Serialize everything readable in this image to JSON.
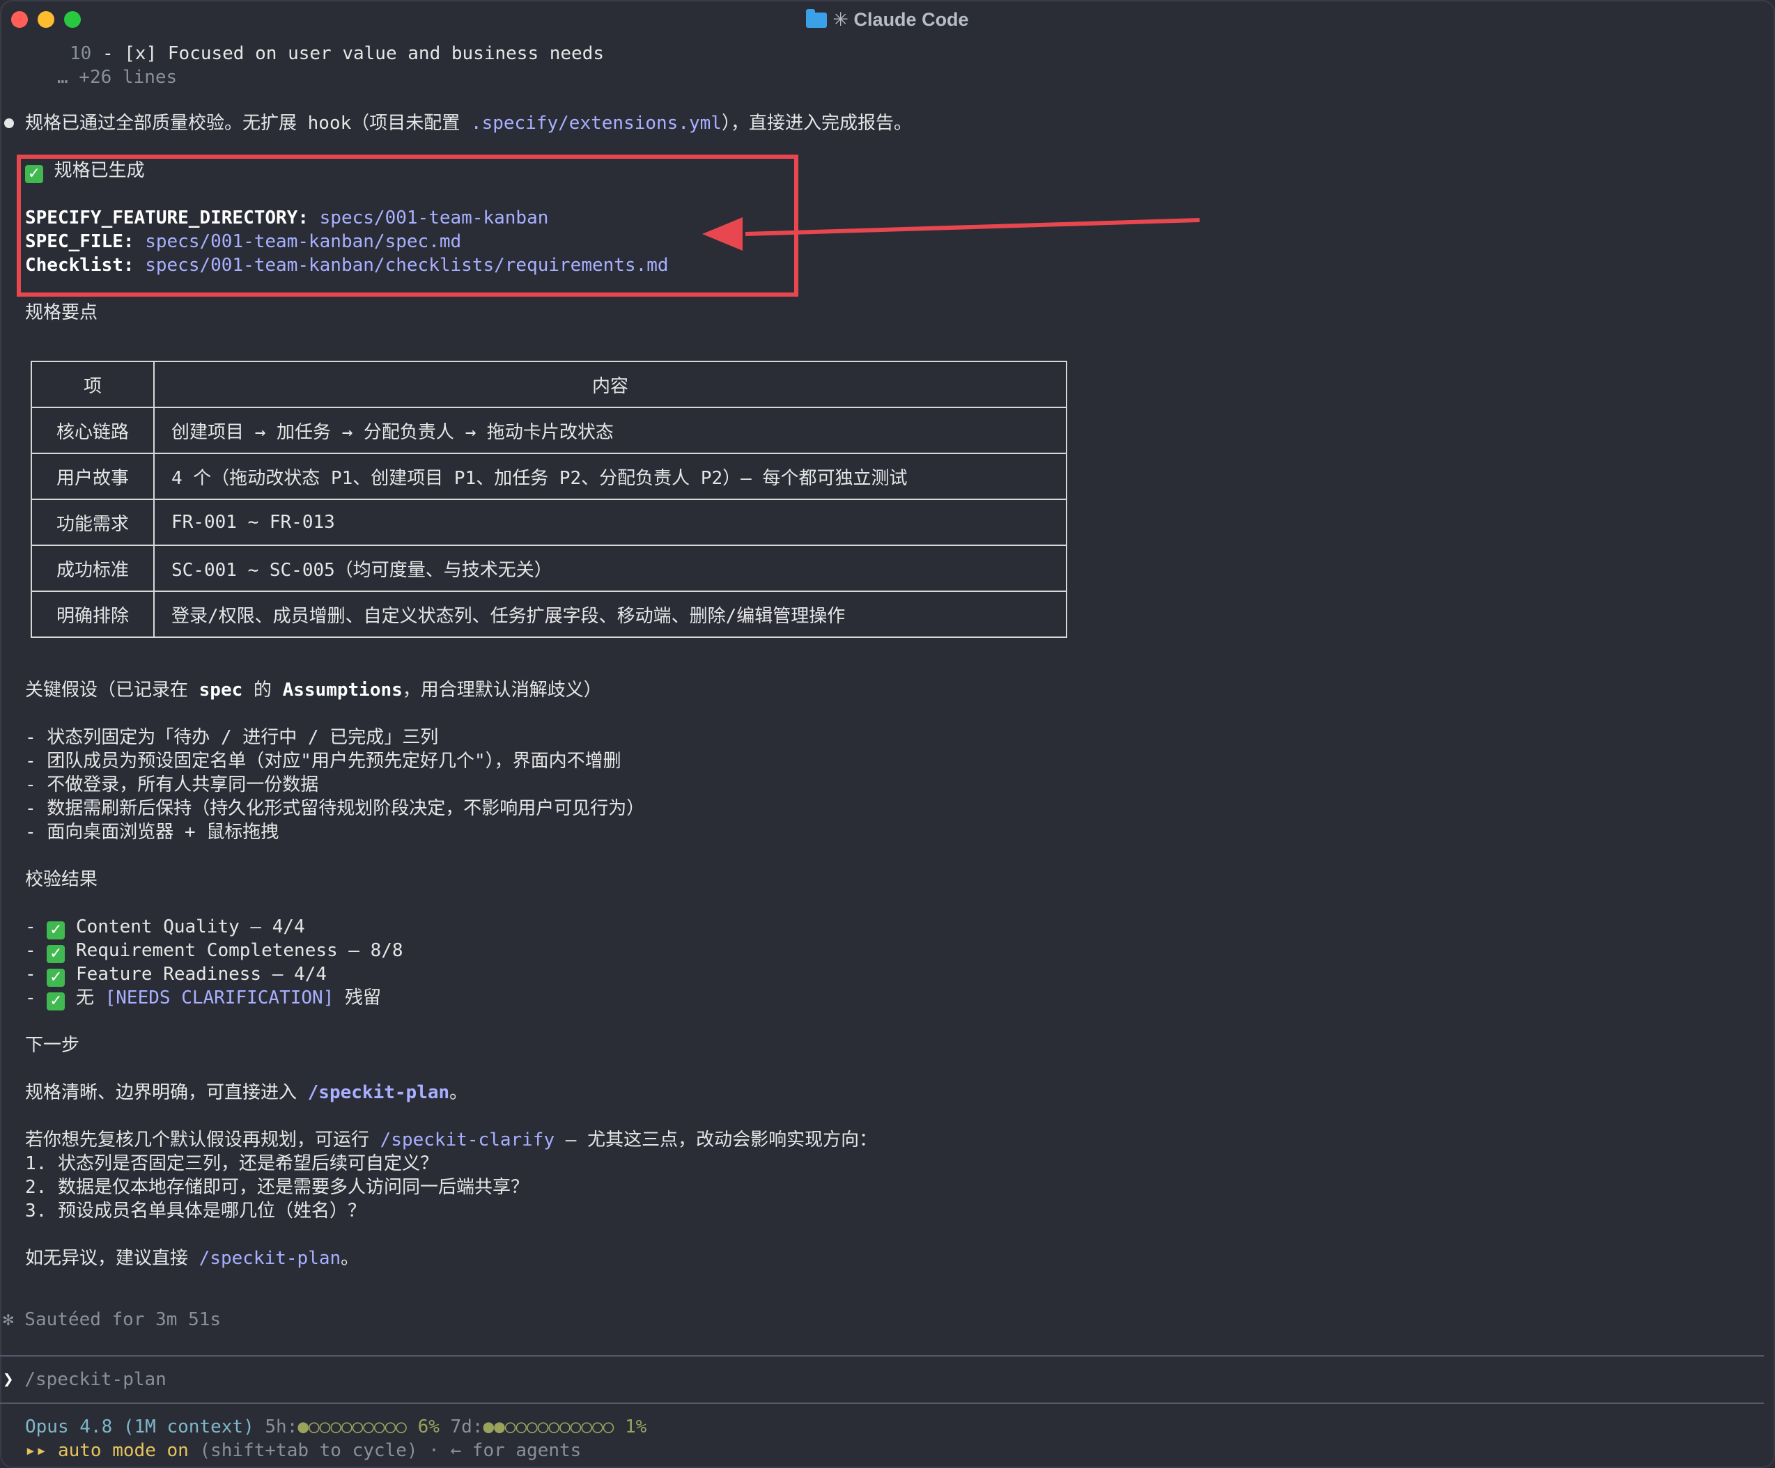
{
  "window": {
    "title": "✳ Claude Code"
  },
  "top": {
    "line_no": "10",
    "checklist_item": " - [x] Focused on user value and business needs",
    "more_lines": "… +26 lines"
  },
  "message": {
    "text_a": "规格已通过全部质量校验。无扩展 hook（项目未配置 ",
    "path": ".specify/extensions.yml",
    "text_b": "），直接进入完成报告。"
  },
  "generated": {
    "heading": "规格已生成",
    "dir_label": "SPECIFY_FEATURE_DIRECTORY",
    "dir_value": "specs/001-team-kanban",
    "spec_label": "SPEC_FILE",
    "spec_value": "specs/001-team-kanban/spec.md",
    "check_label": "Checklist",
    "check_value": "specs/001-team-kanban/checklists/requirements.md"
  },
  "points_heading": "规格要点",
  "table": {
    "headers": [
      "项",
      "内容"
    ],
    "rows": [
      [
        "核心链路",
        "创建项目 → 加任务 → 分配负责人 → 拖动卡片改状态"
      ],
      [
        "用户故事",
        "4 个（拖动改状态 P1、创建项目 P1、加任务 P2、分配负责人 P2）— 每个都可独立测试"
      ],
      [
        "功能需求",
        "FR-001 ~ FR-013"
      ],
      [
        "成功标准",
        "SC-001 ~ SC-005（均可度量、与技术无关）"
      ],
      [
        "明确排除",
        "登录/权限、成员增删、自定义状态列、任务扩展字段、移动端、删除/编辑管理操作"
      ]
    ]
  },
  "assumptions": {
    "heading_a": "关键假设（已记录在 ",
    "heading_spec": "spec",
    "heading_b": " 的 ",
    "heading_assump": "Assumptions",
    "heading_c": "，用合理默认消解歧义）",
    "items": [
      "- 状态列固定为「待办 / 进行中 / 已完成」三列",
      "- 团队成员为预设固定名单（对应\"用户先预先定好几个\"），界面内不增删",
      "- 不做登录，所有人共享同一份数据",
      "- 数据需刷新后保持（持久化形式留待规划阶段决定，不影响用户可见行为）",
      "- 面向桌面浏览器 + 鼠标拖拽"
    ]
  },
  "validation": {
    "heading": "校验结果",
    "items": [
      "Content Quality — 4/4",
      "Requirement Completeness — 8/8",
      "Feature Readiness — 4/4"
    ],
    "last_a": "无 ",
    "last_tag": "[NEEDS CLARIFICATION]",
    "last_b": " 残留"
  },
  "next": {
    "heading": "下一步",
    "line1_a": "规格清晰、边界明确，可直接进入 ",
    "line1_cmd": "/speckit-plan",
    "line1_b": "。",
    "line2_a": "若你想先复核几个默认假设再规划，可运行 ",
    "line2_cmd": "/speckit-clarify",
    "line2_b": " — 尤其这三点，改动会影响实现方向：",
    "questions": [
      "1. 状态列是否固定三列，还是希望后续可自定义？",
      "2. 数据是仅本地存储即可，还是需要多人访问同一后端共享？",
      "3. 预设成员名单具体是哪几位（姓名）？"
    ],
    "final_a": "如无异议，建议直接 ",
    "final_cmd": "/speckit-plan",
    "final_b": "。"
  },
  "status": {
    "sauteed": "✻ Sautéed for 3m 51s"
  },
  "prompt": {
    "caret": "❯",
    "value": "/speckit-plan"
  },
  "footer": {
    "model": "Opus 4.8 (1M context)",
    "h5_label": "5h:",
    "h5_bar": "●○○○○○○○○○",
    "h5_pct": "6%",
    "d7_label": "7d:",
    "d7_bar": "●●○○○○○○○○○○",
    "d7_pct": "1%",
    "mode_icon": "▸▸",
    "mode_text": "auto mode on",
    "mode_hint": " (shift+tab to cycle) · ← for agents"
  },
  "colors": {
    "background": "#2a2d36",
    "link": "#a8b0ff",
    "highlight": "#e8474f",
    "check": "#3fb950",
    "mode": "#e6c35c"
  }
}
